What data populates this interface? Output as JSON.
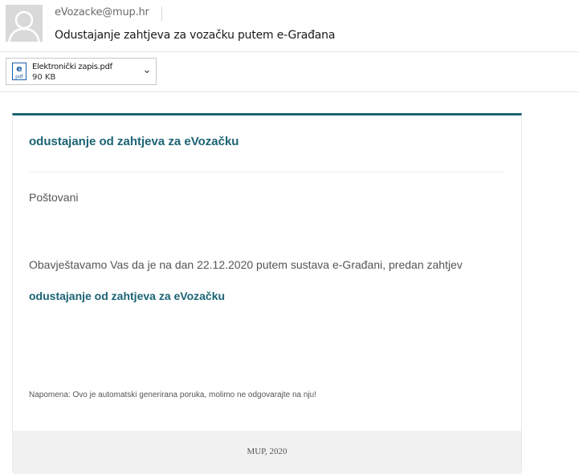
{
  "email": {
    "sender": "eVozacke@mup.hr",
    "subject": "Odustajanje zahtjeva za vozačku putem e-Građana"
  },
  "attachment": {
    "name": "Elektronički zapis.pdf",
    "size": "90 KB",
    "icon_label": "pdf",
    "icon_letter": "e",
    "icon": "pdf-icon"
  },
  "message": {
    "title": "odustajanje od zahtjeva za eVozačku",
    "greeting": "Poštovani",
    "notice": "Obavještavamo Vas da je na dan 22.12.2020 putem sustava e-Građani, predan zahtjev",
    "request_name": "odustajanje od zahtjeva za eVozačku",
    "napomena": "Napomena: Ovo je automatski generirana poruka, molimo ne odgovarajte na nju!",
    "footer": "MUP, 2020"
  },
  "colors": {
    "accent": "#1b6374",
    "pdf_icon": "#1a5fa8"
  }
}
